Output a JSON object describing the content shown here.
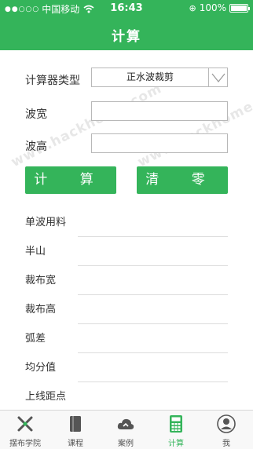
{
  "status_bar": {
    "carrier": "中国移动",
    "time": "16:43",
    "battery": "100%"
  },
  "header": {
    "title": "计算"
  },
  "form": {
    "type_label": "计算器类型",
    "type_value": "正水波裁剪",
    "width_label": "波宽",
    "width_value": "",
    "height_label": "波高",
    "height_value": ""
  },
  "buttons": {
    "calc": "计 算",
    "clear": "清 零"
  },
  "results": [
    {
      "label": "单波用料",
      "value": ""
    },
    {
      "label": "半山",
      "value": ""
    },
    {
      "label": "裁布宽",
      "value": ""
    },
    {
      "label": "裁布高",
      "value": ""
    },
    {
      "label": "弧差",
      "value": ""
    },
    {
      "label": "均分值",
      "value": ""
    },
    {
      "label": "上线距点",
      "value": ""
    }
  ],
  "watermark": "www.hackhome.com",
  "tabs": [
    {
      "label": "摆布学院",
      "icon": "academy-icon"
    },
    {
      "label": "课程",
      "icon": "book-icon"
    },
    {
      "label": "案例",
      "icon": "cloud-icon"
    },
    {
      "label": "计算",
      "icon": "calculator-icon",
      "active": true
    },
    {
      "label": "我",
      "icon": "user-icon"
    }
  ],
  "colors": {
    "accent": "#34b45a"
  }
}
